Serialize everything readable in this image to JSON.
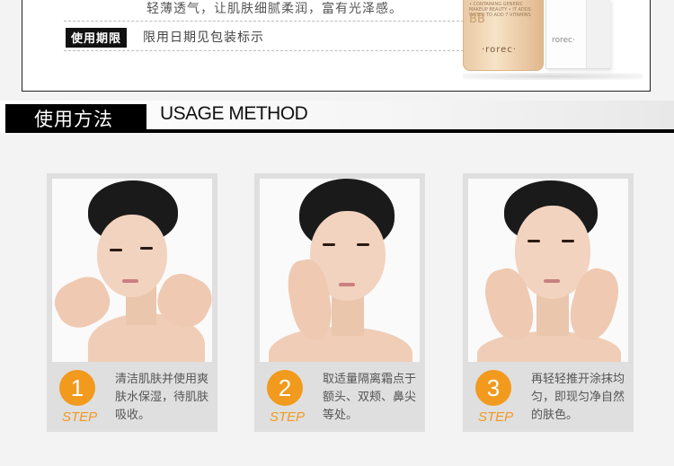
{
  "top": {
    "desc_line": "轻薄透气，让肌肤细腻柔润，富有光泽感。",
    "term_label": "使用期限",
    "term_value": "限用日期见包装标示",
    "bottle_bb": "BB",
    "bottle_brand": "·rorec·",
    "bottle_small": "• CONTAINING GENERIC MAKEUP BEAUTY • IT ADDS WATER TO ADD 7 VITAMINS",
    "box_brand": "rorec·"
  },
  "header": {
    "title_cn": "使用方法",
    "title_en": "USAGE METHOD"
  },
  "steps": [
    {
      "number": "1",
      "label": "STEP",
      "text": "清洁肌肤并使用爽肤水保湿，待肌肤吸收。"
    },
    {
      "number": "2",
      "label": "STEP",
      "text": "取适量隔离霜点于额头、双颊、鼻尖等处。"
    },
    {
      "number": "3",
      "label": "STEP",
      "text": "再轻轻推开涂抹均匀，即现匀净自然的肤色。"
    }
  ],
  "colors": {
    "accent": "#f19a1d",
    "band": "#000000",
    "card_bg": "#dfdfdf"
  }
}
